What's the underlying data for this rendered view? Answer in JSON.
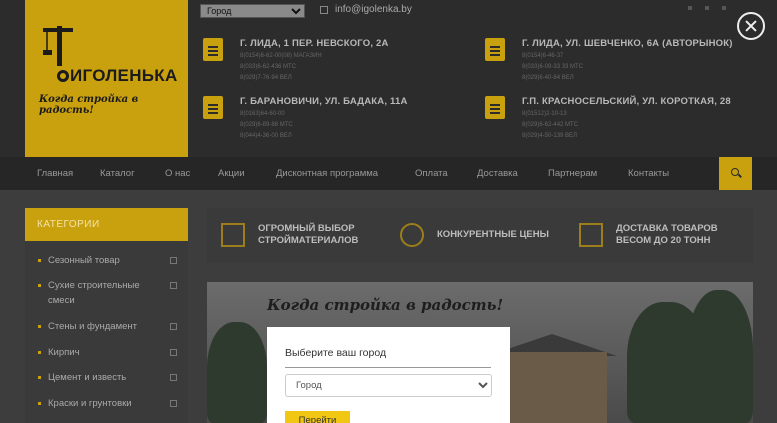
{
  "brand": {
    "name": "ИГОЛЕНЬКА",
    "slogan": "Когда стройка в радость!"
  },
  "top_bar": {
    "city_select_value": "Город",
    "email": "info@igolenka.by"
  },
  "stores": [
    {
      "address": "Г. ЛИДА, 1 ПЕР. НЕВСКОГО, 2А",
      "lines": [
        "8(0154)6-62-00(08) МАГАЗИН",
        "8(033)6-62-436 МТС",
        "8(029)7-76-94 ВЕЛ"
      ]
    },
    {
      "address": "Г. ЛИДА, УЛ. ШЕВЧЕНКО, 6А (АВТОРЫНОК)",
      "lines": [
        "8(0154)6-46-37",
        "8(033)6-09-33 33 МТС",
        "8(029)6-40-84 ВЕЛ"
      ]
    },
    {
      "address": "Г. БАРАНОВИЧИ, УЛ. БАДАКА, 11А",
      "lines": [
        "8(0163)64-60-00",
        "8(029)6-89-88 МТС",
        "8(044)4-36-00 ВЕЛ"
      ]
    },
    {
      "address": "Г.П. КРАСНОСЕЛЬСКИЙ, УЛ. КОРОТКАЯ, 28",
      "lines": [
        "8(01512)2-10-13",
        "8(029)6-62-442 МТС",
        "8(029)4-50-139 ВЕЛ"
      ]
    }
  ],
  "nav": {
    "items": [
      "Главная",
      "Каталог",
      "О нас",
      "Акции",
      "Дисконтная программа",
      "Оплата",
      "Доставка",
      "Партнерам",
      "Контакты"
    ]
  },
  "sidebar": {
    "title": "КАТЕГОРИИ",
    "categories": [
      "Сезонный товар",
      "Сухие строительные смеси",
      "Стены и фундамент",
      "Кирпич",
      "Цемент и известь",
      "Краски и грунтовки"
    ]
  },
  "features": [
    {
      "line1": "ОГРОМНЫЙ ВЫБОР",
      "line2": "СТРОЙМАТЕРИАЛОВ",
      "icon": "catalog-icon"
    },
    {
      "line1": "КОНКУРЕНТНЫЕ ЦЕНЫ",
      "line2": "",
      "icon": "coin-icon"
    },
    {
      "line1": "ДОСТАВКА ТОВАРОВ",
      "line2": "ВЕСОМ ДО 20 ТОНН",
      "icon": "box-icon"
    }
  ],
  "banner": {
    "slogan": "Когда стройка в радость!"
  },
  "modal": {
    "title": "Выберите ваш город",
    "select_value": "Город",
    "go_label": "Перейти"
  },
  "colors": {
    "accent": "#c9a10e",
    "button": "#f2c713",
    "header_bg": "#2c2c2c"
  }
}
